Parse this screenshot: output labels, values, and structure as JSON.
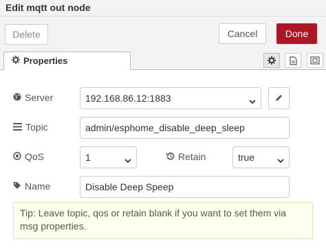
{
  "window": {
    "title": "Edit mqtt out node"
  },
  "toolbar": {
    "delete_label": "Delete",
    "cancel_label": "Cancel",
    "done_label": "Done",
    "done_color": "#ad1625"
  },
  "tabs": [
    {
      "label": "Properties",
      "icon": "gear-icon"
    }
  ],
  "tab_icons": [
    "gear-icon",
    "document-icon",
    "frame-icon"
  ],
  "form": {
    "server": {
      "label": "Server",
      "icon": "globe-icon",
      "value": "192.168.86.12:1883"
    },
    "topic": {
      "label": "Topic",
      "icon": "list-icon",
      "value": "admin/esphome_disable_deep_sleep"
    },
    "qos": {
      "label": "QoS",
      "icon": "dial-icon",
      "value": "1"
    },
    "retain": {
      "label": "Retain",
      "icon": "history-icon",
      "value": "true"
    },
    "name": {
      "label": "Name",
      "icon": "tag-icon",
      "value": "Disable Deep Speep"
    }
  },
  "tip": {
    "text": "Tip: Leave topic, qos or retain blank if you want to set them via msg properties."
  }
}
